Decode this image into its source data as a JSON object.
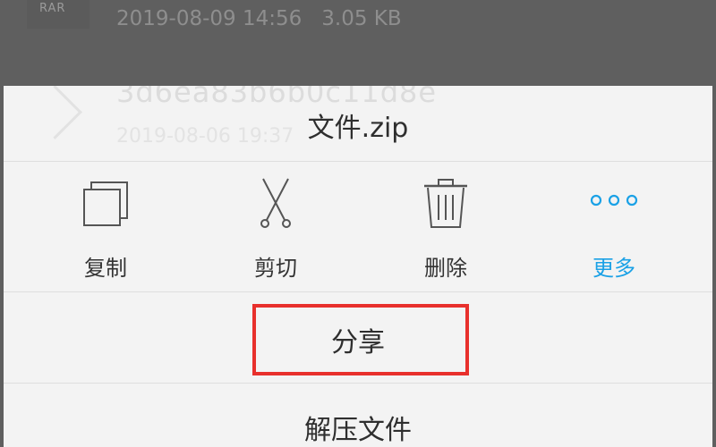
{
  "background_list": {
    "row1": {
      "icon_label": "RAR",
      "date": "2019-08-09 14:56",
      "size": "3.05 KB"
    },
    "row2": {
      "name": "3d6ea83b6b0c11d8e",
      "date": "2019-08-06 19:37"
    }
  },
  "sheet": {
    "title": "文件.zip",
    "actions": [
      {
        "label": "复制",
        "icon": "copy-icon"
      },
      {
        "label": "剪切",
        "icon": "scissors-icon"
      },
      {
        "label": "删除",
        "icon": "trash-icon"
      },
      {
        "label": "更多",
        "icon": "more-dots-icon"
      }
    ],
    "menu": {
      "share": "分享",
      "extract": "解压文件"
    }
  },
  "colors": {
    "accent": "#1aa1e6",
    "highlight": "#e8302c",
    "overlay": "#5f5f5f",
    "sheet_bg": "#f3f3f3"
  }
}
